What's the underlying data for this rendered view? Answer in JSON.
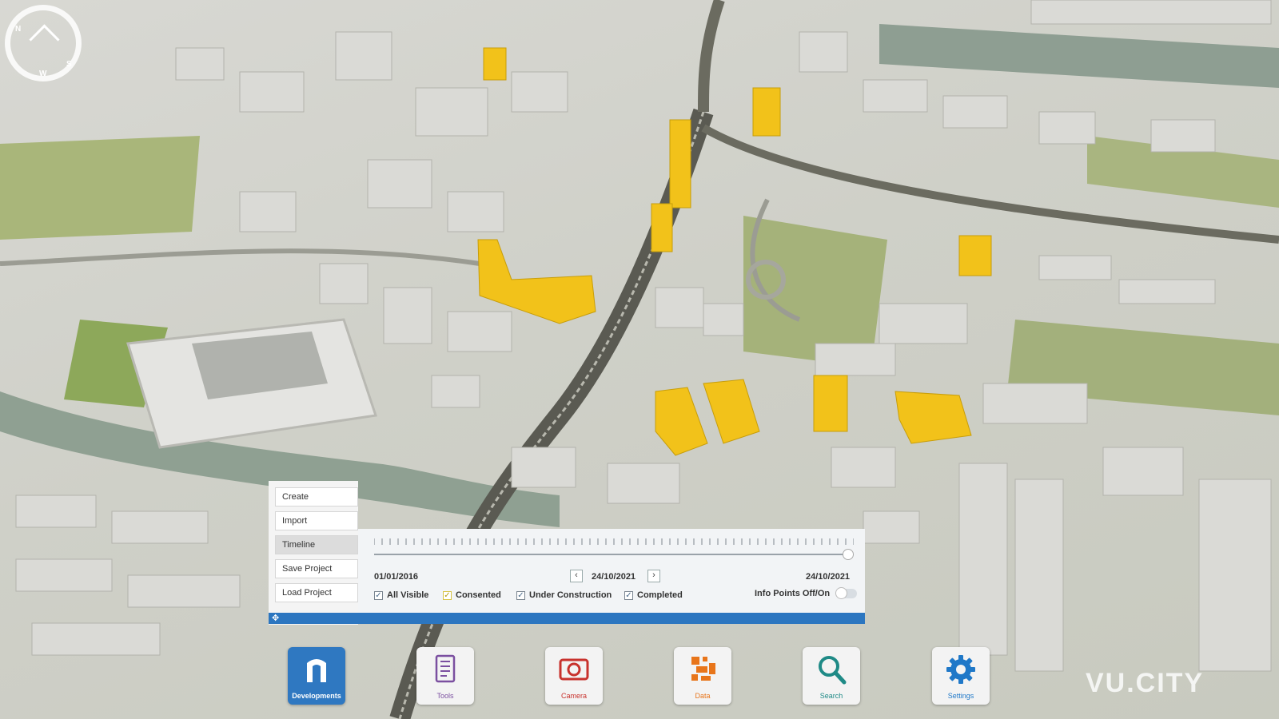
{
  "compass": {
    "letters": [
      "N",
      "E",
      "S",
      "W"
    ]
  },
  "side_menu": {
    "items": [
      {
        "label": "Create",
        "active": false
      },
      {
        "label": "Import",
        "active": false
      },
      {
        "label": "Timeline",
        "active": true
      },
      {
        "label": "Save Project",
        "active": false
      },
      {
        "label": "Load Project",
        "active": false
      }
    ]
  },
  "timeline": {
    "start_date": "01/01/2016",
    "current_date": "24/10/2021",
    "end_date": "24/10/2021",
    "position_fraction": 1.0,
    "prev_icon": "chevron-left-icon",
    "next_icon": "chevron-right-icon",
    "filters": [
      {
        "label": "All Visible",
        "checked": true,
        "color": "#7a8590"
      },
      {
        "label": "Consented",
        "checked": true,
        "color": "#d8c447"
      },
      {
        "label": "Under Construction",
        "checked": true,
        "color": "#7a8590"
      },
      {
        "label": "Completed",
        "checked": true,
        "color": "#7a8590"
      }
    ],
    "info_points_label": "Info Points Off/On",
    "info_points_on": false,
    "drag_icon": "move-icon"
  },
  "dock": {
    "items": [
      {
        "label": "Developments",
        "icon": "developments-icon",
        "active": true
      },
      {
        "label": "Tools",
        "icon": "tools-icon",
        "active": false
      },
      {
        "label": "Camera",
        "icon": "camera-icon",
        "active": false
      },
      {
        "label": "Data",
        "icon": "data-icon",
        "active": false
      },
      {
        "label": "Search",
        "icon": "search-icon",
        "active": false
      },
      {
        "label": "Settings",
        "icon": "gear-icon",
        "active": false
      }
    ]
  },
  "watermark": "VU.CITY",
  "colors": {
    "accent_blue": "#2f78c1",
    "development_yellow": "#f2c21a",
    "tools_purple": "#7b4fa0",
    "camera_red": "#c8322d",
    "data_orange": "#e8751a",
    "search_teal": "#1f8a86",
    "settings_blue": "#1f78c8"
  }
}
